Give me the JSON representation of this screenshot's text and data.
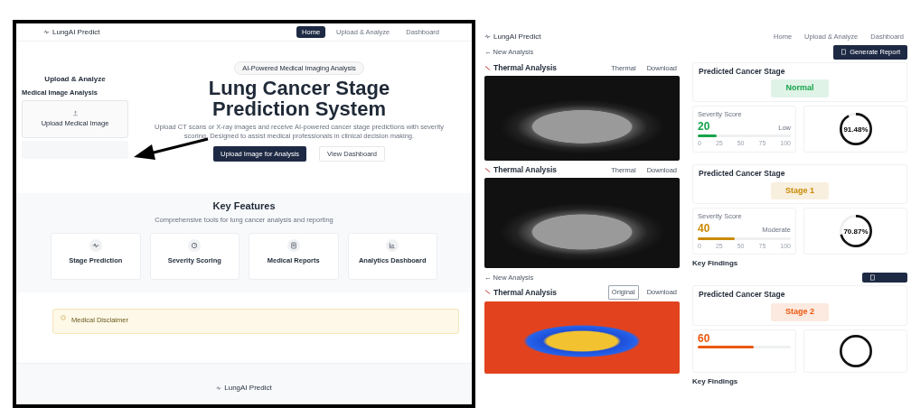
{
  "home_screen": {
    "nav": {
      "brand": "LungAI Predict",
      "links": [
        {
          "label": "Home",
          "selected": true
        },
        {
          "label": "Upload & Analyze",
          "selected": false
        },
        {
          "label": "Dashboard",
          "selected": false
        }
      ]
    },
    "side_inset": {
      "title": "Upload & Analyze",
      "section": "Medical Image Analysis",
      "upload_label": "Upload Medical Image"
    },
    "badge": "AI-Powered Medical Imaging Analysis",
    "title": "Lung Cancer Stage Prediction System",
    "description": "Upload CT scans or X-ray images and receive AI-powered cancer stage predictions with severity scoring. Designed to assist medical professionals in clinical decision making.",
    "buttons": [
      {
        "label": "Upload Image for Analysis",
        "kind": "primary"
      },
      {
        "label": "View Dashboard",
        "kind": "outline"
      }
    ],
    "features": {
      "title": "Key Features",
      "subtitle": "Comprehensive tools for lung cancer analysis and reporting",
      "items": [
        {
          "title": "Stage Prediction"
        },
        {
          "title": "Severity Scoring"
        },
        {
          "title": "Medical Reports"
        },
        {
          "title": "Analytics Dashboard"
        }
      ]
    },
    "disclaimer": {
      "title": "Medical Disclaimer"
    },
    "footer": {
      "brand": "LungAI Predict"
    }
  },
  "results": [
    {
      "nav": {
        "brand": "LungAI Predict",
        "links": [
          {
            "label": "Home",
            "selected": false
          },
          {
            "label": "Upload & Analyze",
            "selected": false
          },
          {
            "label": "Dashboard",
            "selected": false
          }
        ]
      },
      "back_link": "← New Analysis",
      "generate_button": "Generate Report",
      "image_panel": {
        "title": "Thermal Analysis",
        "view_button": "Thermal",
        "download_button": "Download",
        "kind": "grayscale"
      },
      "stage": {
        "title": "Predicted Cancer Stage",
        "value": "Normal",
        "color": "#16a34a"
      },
      "severity": {
        "label": "Severity Score",
        "score": "20",
        "rating": "Low",
        "level": 0.2,
        "ticks": [
          "0",
          "25",
          "50",
          "75",
          "100"
        ]
      },
      "confidence": {
        "value": "91.48%"
      }
    },
    {
      "image_panel": {
        "title": "Thermal Analysis",
        "view_button": "Thermal",
        "download_button": "Download",
        "kind": "grayscale"
      },
      "stage": {
        "title": "Predicted Cancer Stage",
        "value": "Stage 1",
        "color": "#ca8a04"
      },
      "severity": {
        "label": "Severity Score",
        "score": "40",
        "rating": "Moderate",
        "level": 0.4,
        "ticks": [
          "0",
          "25",
          "50",
          "75",
          "100"
        ]
      },
      "confidence": {
        "value": "70.87%"
      },
      "key_findings": "Key Findings"
    },
    {
      "back_link": "← New Analysis",
      "report_button": true,
      "image_panel": {
        "title": "Thermal Analysis",
        "view_button": "Original",
        "download_button": "Download",
        "kind": "thermal"
      },
      "stage": {
        "title": "Predicted Cancer Stage",
        "value": "Stage 2",
        "color": "#ea580c"
      },
      "severity": {
        "score": "60",
        "level": 0.6
      },
      "key_findings": "Key Findings"
    }
  ]
}
